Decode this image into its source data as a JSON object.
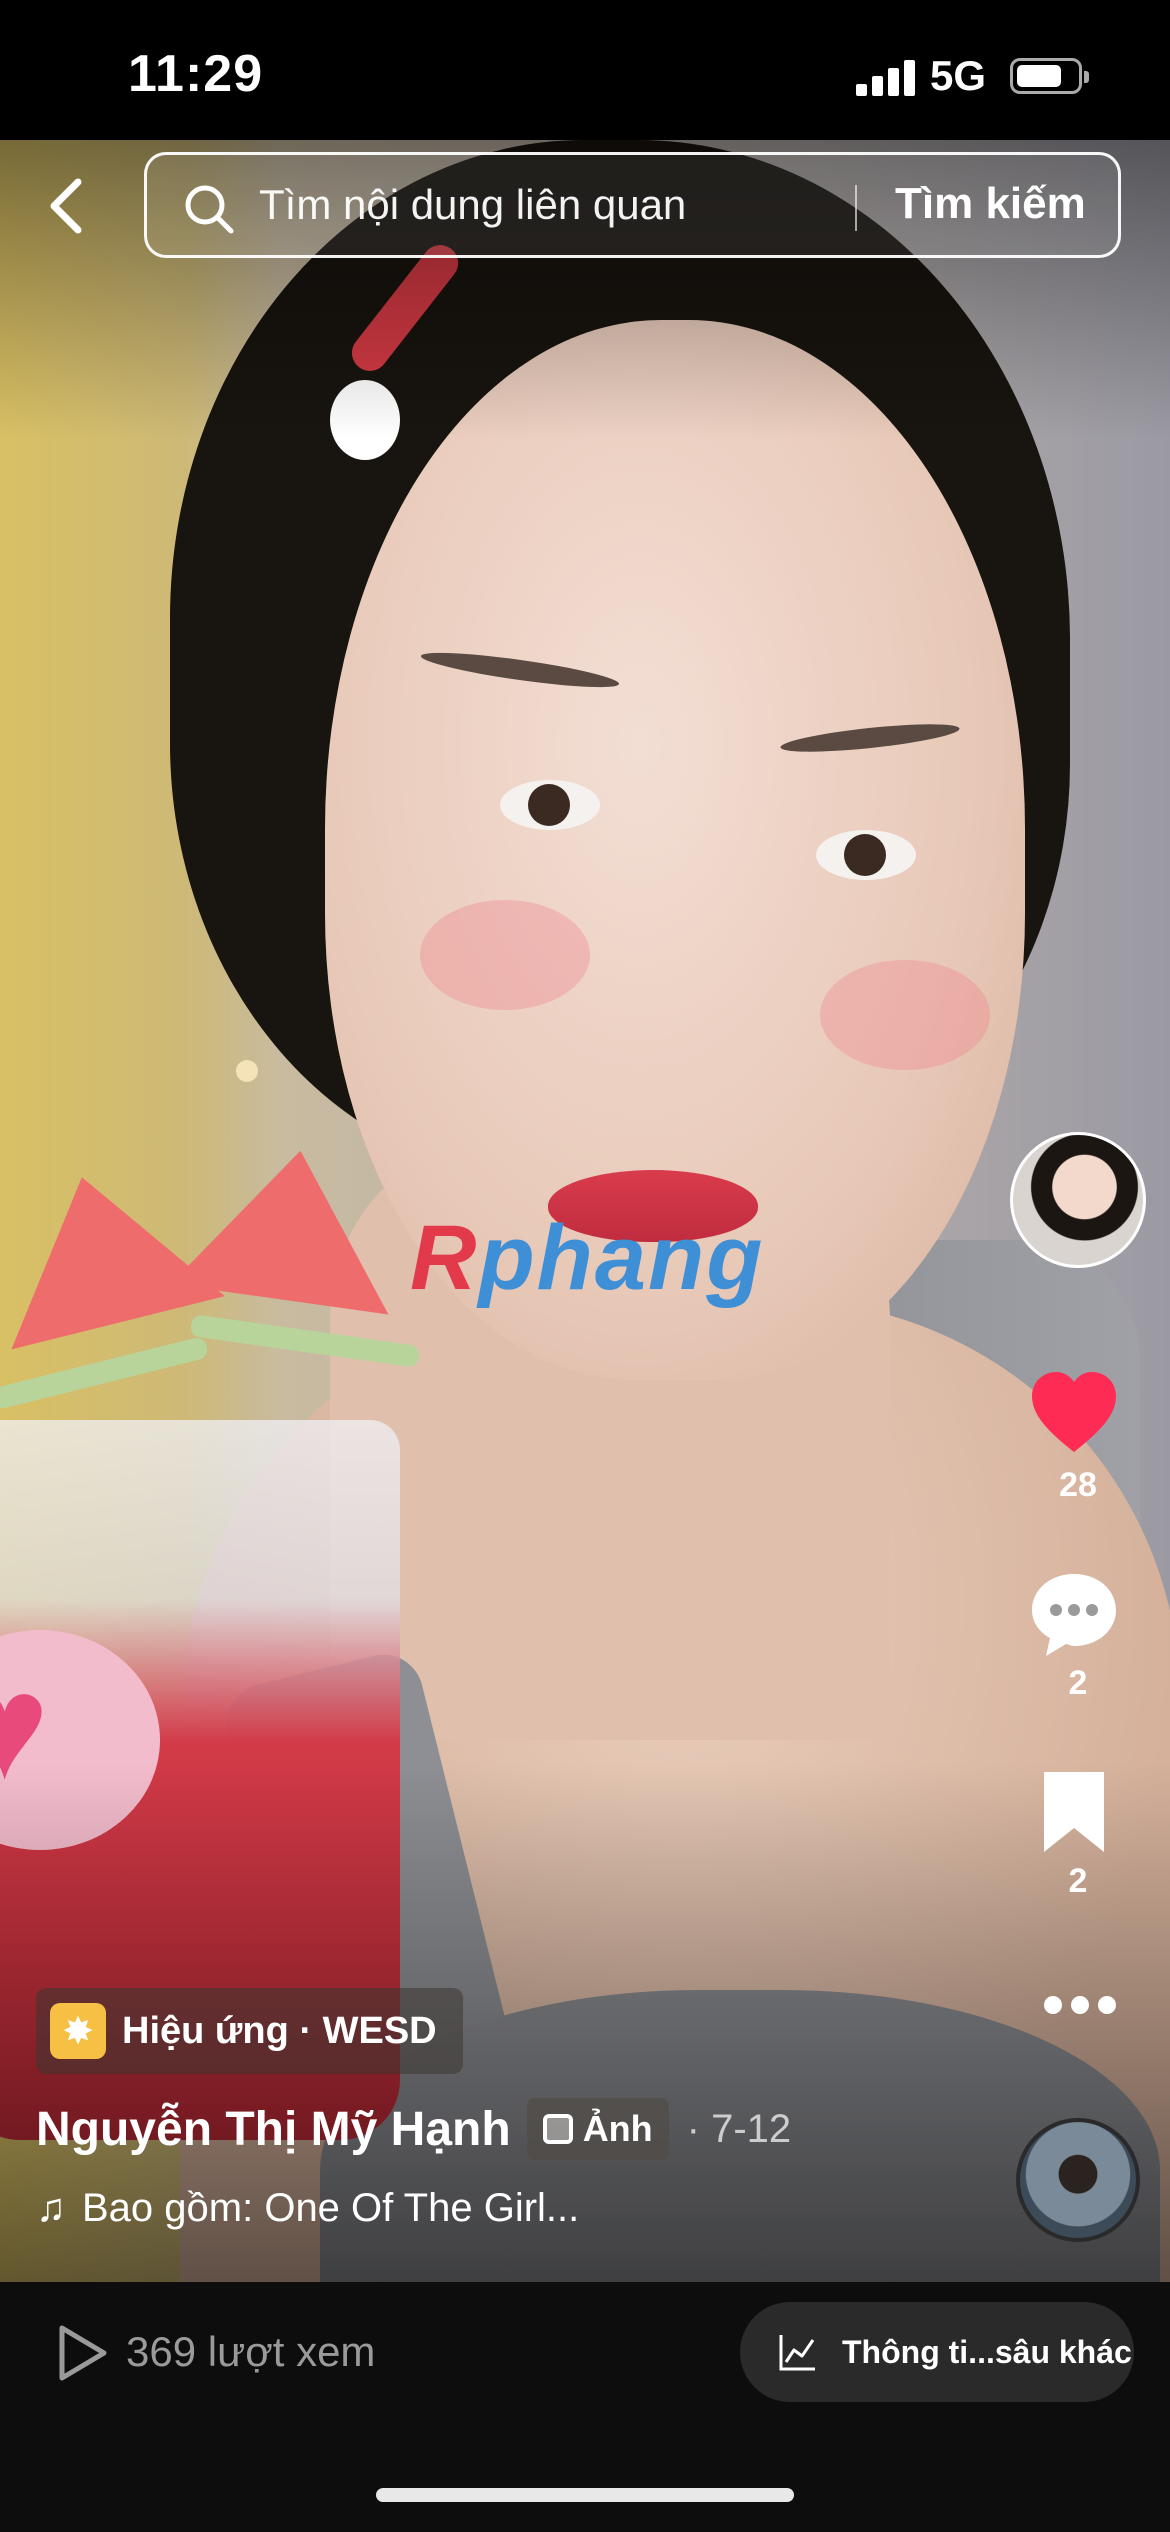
{
  "status_bar": {
    "time": "11:29",
    "network": "5G",
    "battery_level": 0.75
  },
  "search": {
    "placeholder": "Tìm nội dung liên quan",
    "button_label": "Tìm kiếm"
  },
  "post": {
    "effect_label": "Hiệu ứng · WESD",
    "author": "Nguyễn Thị Mỹ Hạnh",
    "content_type": "Ảnh",
    "date": "· 7-12",
    "music": "Bao gồm: One Of The Girl...",
    "watermark_prefix": "R",
    "watermark_rest": "phang"
  },
  "actions": {
    "likes": "28",
    "comments": "2",
    "saves": "2"
  },
  "bottom_bar": {
    "views": "369 lượt xem",
    "insights_label": "Thông ti...sâu khác"
  },
  "colors": {
    "like": "#fe2c55",
    "background": "#000000",
    "chip": "#2a2a2a"
  },
  "icons": [
    "back-icon",
    "search-icon",
    "heart-icon",
    "comment-icon",
    "bookmark-icon",
    "more-icon",
    "music-note-icon",
    "play-icon",
    "chart-icon"
  ]
}
